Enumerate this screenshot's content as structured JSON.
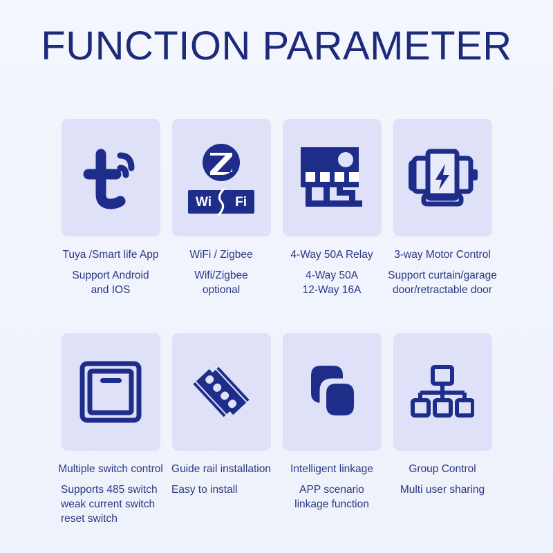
{
  "page": {
    "title": "FUNCTION PARAMETER",
    "background_color": "#f2f4fc",
    "tile_color": "#dee1f8",
    "title_color": "#1d2a7a",
    "text_color": "#2a3784",
    "icon_color": "#1f2d8a"
  },
  "wifi_badge": {
    "left_text": "Wi",
    "right_text": "Fi"
  },
  "features": [
    {
      "icon": "tuya-logo-icon",
      "title": "Tuya /Smart life App",
      "subtitle": "Support Android\nand IOS"
    },
    {
      "icon": "zigbee-wifi-icon",
      "title": "WiFi / Zigbee",
      "subtitle": "Wifi/Zigbee\noptional"
    },
    {
      "icon": "relay-board-icon",
      "title": "4-Way 50A Relay",
      "subtitle": "4-Way 50A\n12-Way 16A"
    },
    {
      "icon": "motor-icon",
      "title": "3-way Motor Control",
      "subtitle": "Support curtain/garage\ndoor/retractable door"
    },
    {
      "icon": "wall-switch-icon",
      "title": "Multiple switch control",
      "subtitle": "Supports 485 switch\nweak current switch\nreset switch"
    },
    {
      "icon": "din-rail-icon",
      "title": "Guide rail installation",
      "subtitle": "Easy to install"
    },
    {
      "icon": "linkage-icon",
      "title": "Intelligent linkage",
      "subtitle": "APP scenario\nlinkage function"
    },
    {
      "icon": "hierarchy-icon",
      "title": "Group Control",
      "subtitle": "Multi user sharing"
    }
  ]
}
